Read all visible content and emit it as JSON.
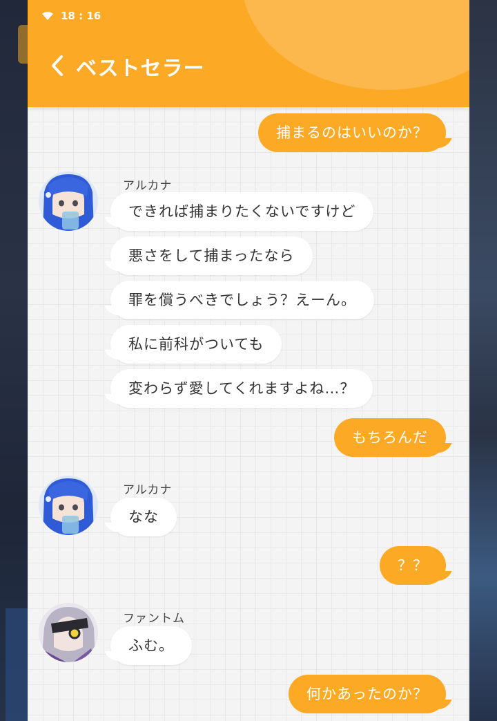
{
  "status_bar": {
    "time": "18 : 16"
  },
  "header": {
    "title": "ベストセラー"
  },
  "messages": [
    {
      "type": "out",
      "text": "捕まるのはいいのか？"
    },
    {
      "type": "sender",
      "text": "アルカナ"
    },
    {
      "type": "in",
      "text": "できれば捕まりたくないですけど"
    },
    {
      "type": "in",
      "text": "悪さをして捕まったなら"
    },
    {
      "type": "in",
      "text": "罪を償うべきでしょう？えーん。"
    },
    {
      "type": "in",
      "text": "私に前科がついても"
    },
    {
      "type": "in",
      "text": "変わらず愛してくれますよね…？"
    },
    {
      "type": "out",
      "text": "もちろんだ"
    },
    {
      "type": "sender",
      "text": "アルカナ"
    },
    {
      "type": "in",
      "text": "なな"
    },
    {
      "type": "out",
      "text": "？？"
    },
    {
      "type": "sender",
      "text": "ファントム"
    },
    {
      "type": "in",
      "text": "ふむ。"
    },
    {
      "type": "out",
      "text": "何かあったのか？"
    }
  ],
  "colors": {
    "accent": "#fca925",
    "panel_bg": "#f4f4f4",
    "bubble_in": "#ffffff"
  },
  "icons": {
    "back": "chevron-left-icon",
    "wifi": "wifi-icon"
  }
}
